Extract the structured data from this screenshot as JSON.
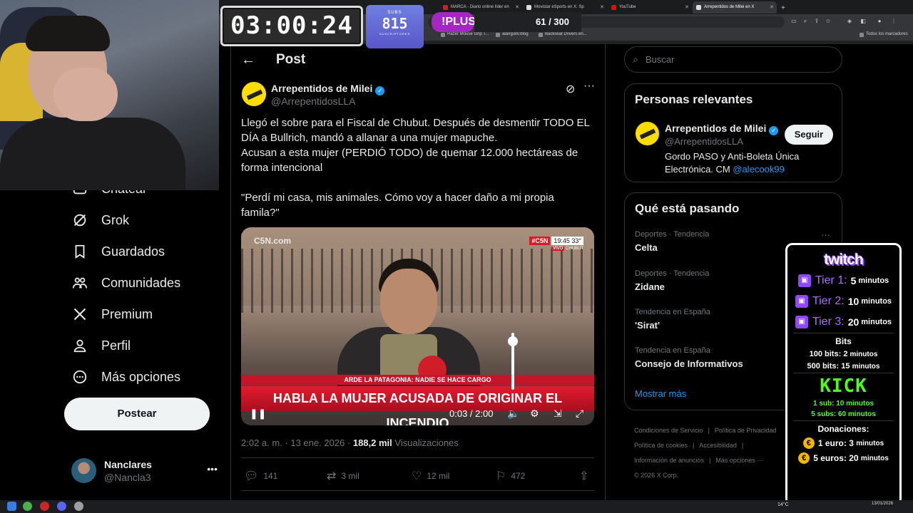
{
  "browser": {
    "tabs": [
      {
        "label": "MARCA - Diario online líder en",
        "color": "#d11c2a"
      },
      {
        "label": "Movistar eSports en X: Sp",
        "color": "#ffffff"
      },
      {
        "label": "YouTube",
        "color": "#ff0000"
      },
      {
        "label": "Arrepentidos de Milei en X",
        "color": "#ffffff",
        "active": true
      }
    ],
    "new_tab": "+",
    "bookmarks": [
      "Razer Mouse Grip T...",
      "alanguitv.blog",
      "Backseat Drivers en...",
      "Todos los marcadores"
    ]
  },
  "stream": {
    "timer": "03:00:24",
    "subs_label": "SUBS",
    "subs_count": "815",
    "subs_sublabel": "SUSCRIPTORES",
    "plus_label": "!PLUS",
    "counter": "61 / 300"
  },
  "nav": {
    "items": [
      {
        "label": "Chatear",
        "icon": "chat-icon"
      },
      {
        "label": "Grok",
        "icon": "grok-icon"
      },
      {
        "label": "Guardados",
        "icon": "bookmark-icon"
      },
      {
        "label": "Comunidades",
        "icon": "communities-icon"
      },
      {
        "label": "Premium",
        "icon": "x-icon"
      },
      {
        "label": "Perfil",
        "icon": "profile-icon"
      },
      {
        "label": "Más opciones",
        "icon": "more-options-icon"
      }
    ],
    "post_button": "Postear",
    "account": {
      "name": "Nanclares",
      "handle": "@Nancla3"
    }
  },
  "post": {
    "header": "Post",
    "author_name": "Arrepentidos de Milei",
    "author_handle": "@ArrepentidosLLA",
    "text": "Llegó el sobre para el Fiscal de Chubut. Después de desmentir TODO EL DÍA a Bullrich, mandó a allanar a una mujer mapuche.\nAcusan a esta mujer (PERDIÓ TODO) de quemar 12.000 hectáreas de forma intencional\n\n\"Perdí mi casa, mis animales. Cómo voy a hacer daño a mi propia famila?\"",
    "video": {
      "watermark": "C5N.com",
      "channel": "#C5N",
      "time": "19:45",
      "temp": "33°",
      "live": "VIVO",
      "location": "CHUBUT",
      "subheadline": "ARDE LA PATAGONIA: NADIE SE HACE CARGO",
      "headline": "HABLA LA MUJER ACUSADA DE ORIGINAR EL INCENDIO",
      "position": "0:03 / 2:00",
      "volume_level": 0.85
    },
    "date": "2:02 a. m. · 13 ene. 2026",
    "views_count": "188,2 mil",
    "views_label": "Visualizaciones",
    "replies": "141",
    "reposts": "3 mil",
    "likes": "12 mil",
    "bookmarks": "472"
  },
  "sidebar": {
    "search_placeholder": "Buscar",
    "relevant": {
      "title": "Personas relevantes",
      "name": "Arrepentidos de Milei",
      "handle": "@ArrepentidosLLA",
      "follow": "Seguir",
      "bio": "Gordo PASO y Anti-Boleta Única Electrónica. CM ",
      "mention": "@alecook99"
    },
    "trends": {
      "title": "Qué está pasando",
      "items": [
        {
          "category": "Deportes · Tendencia",
          "title": "Celta"
        },
        {
          "category": "Deportes · Tendencia",
          "title": "Zidane"
        },
        {
          "category": "Tendencia en España",
          "title": "'Sirat'"
        },
        {
          "category": "Tendencia en España",
          "title": "Consejo de Informativos"
        }
      ],
      "show_more": "Mostrar más"
    },
    "footer": [
      "Condiciones de Servicio",
      "|",
      "Política de Privacidad",
      "Política de cookies",
      "|",
      "Accesibilidad",
      "|",
      "Información de anuncios",
      "|",
      "Más opciones ···",
      "© 2026 X Corp."
    ]
  },
  "subpanel": {
    "twitch": "twitch",
    "tiers": [
      {
        "label": "Tier 1:",
        "value": "5",
        "unit": "minutos"
      },
      {
        "label": "Tier 2:",
        "value": "10",
        "unit": "minutos"
      },
      {
        "label": "Tier 3:",
        "value": "20",
        "unit": "minutos"
      }
    ],
    "bits_title": "Bits",
    "bits": [
      {
        "amount": "100 bits:",
        "value": "2",
        "unit": "minutos"
      },
      {
        "amount": "500 bits:",
        "value": "15",
        "unit": "minutos"
      }
    ],
    "kick": "KICK",
    "kick_rows": [
      "1 sub: 10 minutos",
      "5 subs: 60 minutos"
    ],
    "donations_title": "Donaciones:",
    "donations": [
      {
        "amount": "1 euro:",
        "value": "3",
        "unit": "minutos"
      },
      {
        "amount": "5 euros:",
        "value": "20",
        "unit": "minutos"
      }
    ]
  },
  "taskbar": {
    "temp": "14°C",
    "date": "13/01/2026"
  }
}
